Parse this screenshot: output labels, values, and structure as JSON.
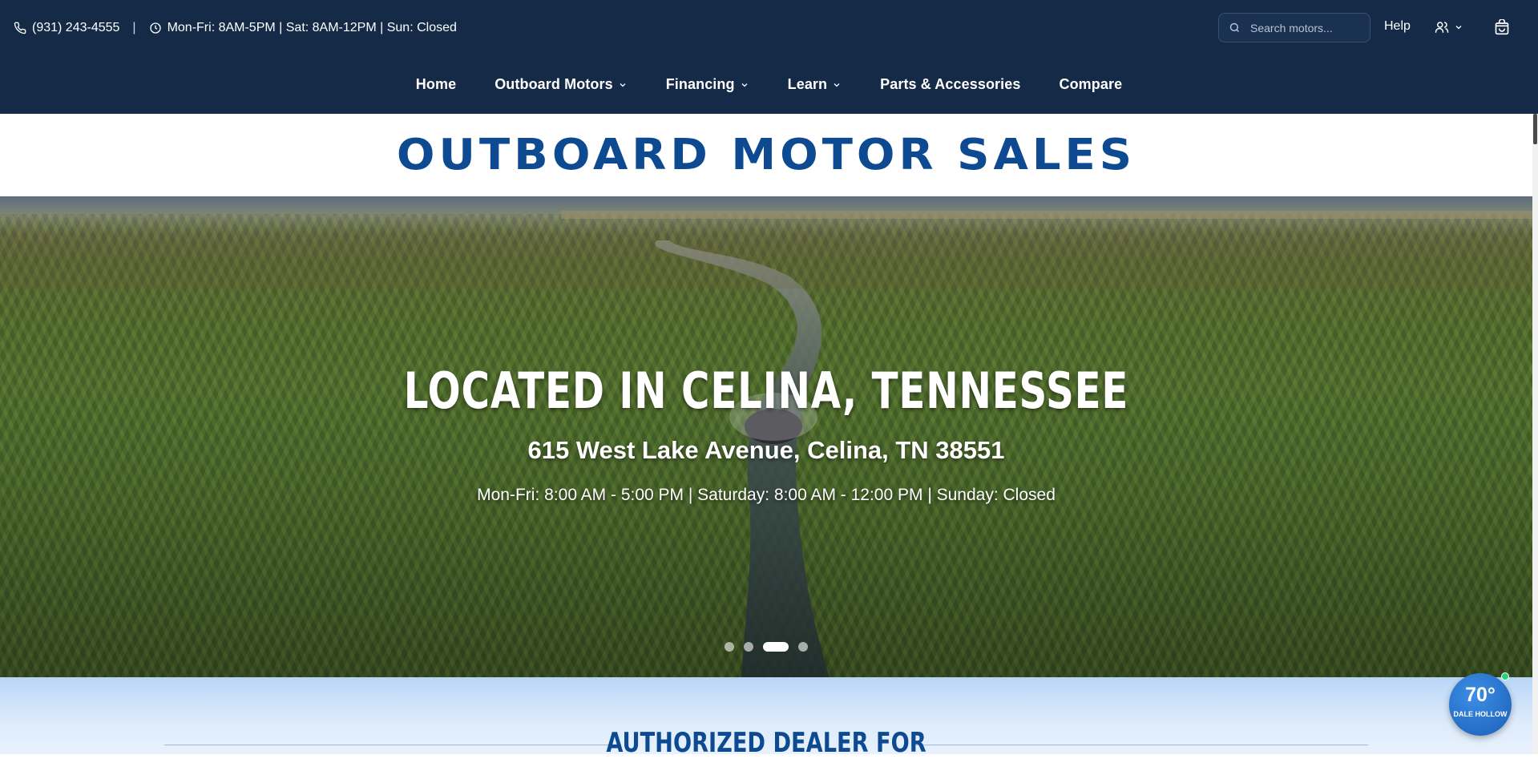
{
  "topbar": {
    "phone": "(931) 243-4555",
    "separator": "|",
    "hours": "Mon-Fri: 8AM-5PM | Sat: 8AM-12PM | Sun: Closed",
    "search_placeholder": "Search motors...",
    "help_label": "Help"
  },
  "nav": {
    "items": [
      {
        "label": "Home"
      },
      {
        "label": "Outboard Motors"
      },
      {
        "label": "Financing"
      },
      {
        "label": "Learn"
      },
      {
        "label": "Parts & Accessories"
      },
      {
        "label": "Compare"
      }
    ]
  },
  "brand": {
    "title": "OUTBOARD MOTOR SALES"
  },
  "hero": {
    "headline": "LOCATED IN CELINA, TENNESSEE",
    "address": "615 West Lake Avenue, Celina, TN 38551",
    "hours": "Mon-Fri: 8:00 AM - 5:00 PM | Saturday: 8:00 AM - 12:00 PM | Sunday: Closed",
    "slides_total": 4,
    "active_slide": 3
  },
  "dealer": {
    "title": "AUTHORIZED DEALER FOR"
  },
  "weather": {
    "temperature": "70°",
    "location": "DALE HOLLOW"
  },
  "colors": {
    "navy": "#142a47",
    "brand_blue": "#0d4a92"
  }
}
